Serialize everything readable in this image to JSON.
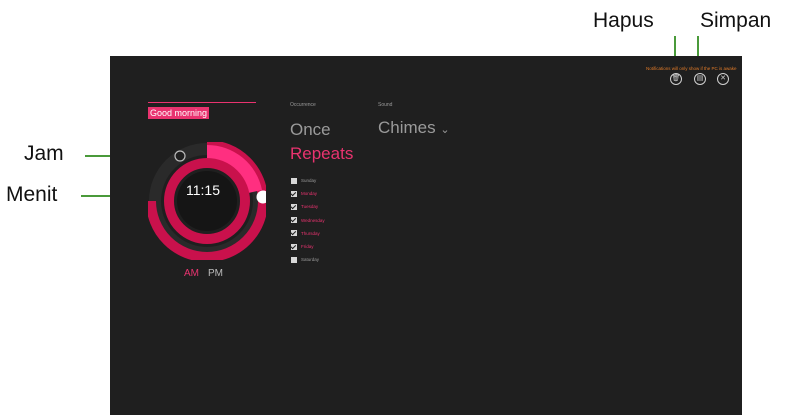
{
  "callouts": {
    "delete": "Hapus",
    "save": "Simpan",
    "hour": "Jam",
    "minute": "Menit"
  },
  "alarm": {
    "name": "Good morning",
    "time": "11:15",
    "am": "AM",
    "pm": "PM",
    "period_selected": "AM"
  },
  "occurrence": {
    "label": "Occurrence",
    "options": [
      "Once",
      "Repeats"
    ],
    "selected": "Repeats"
  },
  "sound": {
    "label": "Sound",
    "value": "Chimes",
    "chevron": "chevron-down-icon"
  },
  "days": [
    {
      "label": "Sunday",
      "checked": false
    },
    {
      "label": "Monday",
      "checked": true
    },
    {
      "label": "Tuesday",
      "checked": true
    },
    {
      "label": "Wednesday",
      "checked": true
    },
    {
      "label": "Thursday",
      "checked": true
    },
    {
      "label": "Friday",
      "checked": true
    },
    {
      "label": "Saturday",
      "checked": false
    }
  ],
  "notice": "Notifications will only show if the PC is awake",
  "toolbar": {
    "delete_icon": "trash-icon",
    "save_icon": "save-icon",
    "close_icon": "close-icon"
  },
  "colors": {
    "accent": "#e9336f",
    "background": "#1f1f1f",
    "callout_line": "#4a9a3a",
    "notice": "#e07a28"
  }
}
